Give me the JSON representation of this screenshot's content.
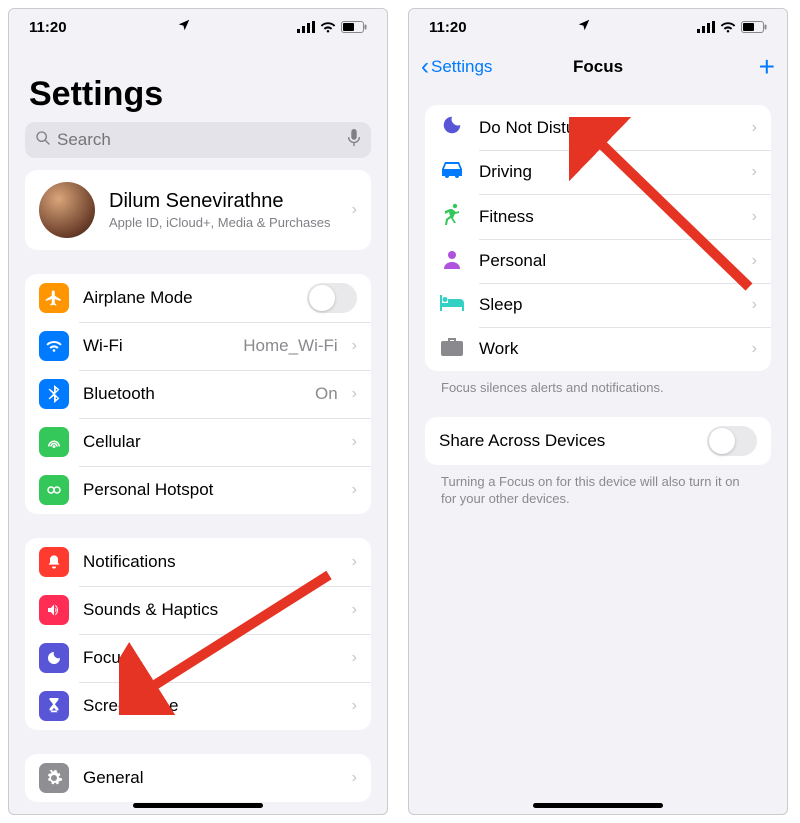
{
  "status": {
    "time": "11:20"
  },
  "left": {
    "large_title": "Settings",
    "search_placeholder": "Search",
    "profile": {
      "name": "Dilum Senevirathne",
      "sub": "Apple ID, iCloud+, Media & Purchases"
    },
    "g1": {
      "airplane": "Airplane Mode",
      "wifi": "Wi-Fi",
      "wifi_value": "Home_Wi-Fi",
      "bluetooth": "Bluetooth",
      "bluetooth_value": "On",
      "cellular": "Cellular",
      "hotspot": "Personal Hotspot"
    },
    "g2": {
      "notifications": "Notifications",
      "sounds": "Sounds & Haptics",
      "focus": "Focus",
      "screentime": "Screen Time"
    },
    "g3": {
      "general": "General"
    }
  },
  "right": {
    "back": "Settings",
    "title": "Focus",
    "modes": {
      "dnd": "Do Not Disturb",
      "driving": "Driving",
      "fitness": "Fitness",
      "personal": "Personal",
      "sleep": "Sleep",
      "work": "Work"
    },
    "caption1": "Focus silences alerts and notifications.",
    "share_label": "Share Across Devices",
    "caption2": "Turning a Focus on for this device will also turn it on for your other devices."
  },
  "colors": {
    "orange": "#ff9500",
    "blue": "#007aff",
    "green": "#34c759",
    "red": "#ff3b30",
    "redpink": "#ff2d55",
    "indigo": "#5856d6",
    "gray": "#8e8e93",
    "teal": "#32d1c4",
    "mint": "#00c7a0",
    "purple": "#af52de"
  }
}
